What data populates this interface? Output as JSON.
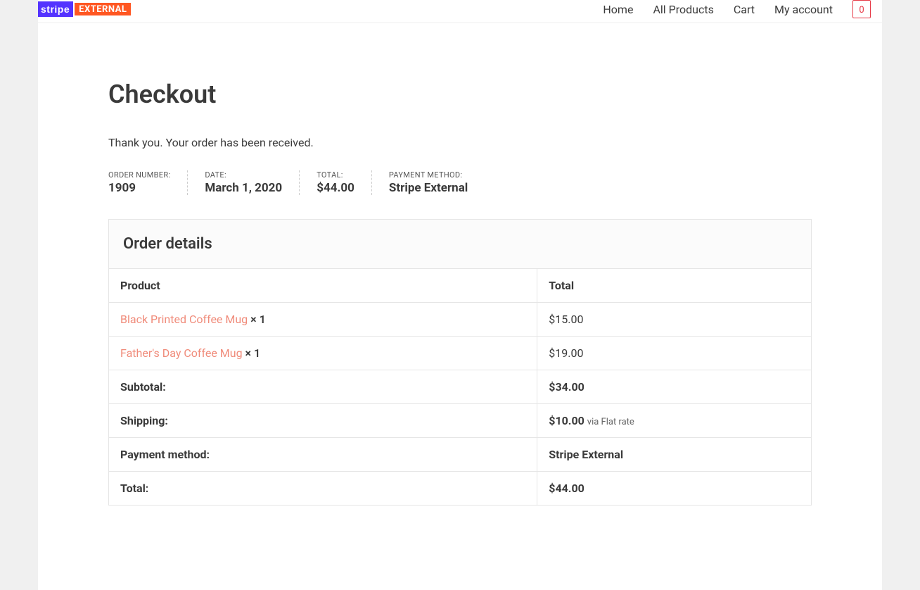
{
  "logo": {
    "part1": "stripe",
    "part2": "EXTERNAL"
  },
  "nav": {
    "home": "Home",
    "all_products": "All Products",
    "cart": "Cart",
    "my_account": "My account",
    "cart_count": "0"
  },
  "page": {
    "title": "Checkout",
    "thankyou": "Thank you. Your order has been received."
  },
  "meta": {
    "order_number_label": "ORDER NUMBER:",
    "order_number": "1909",
    "date_label": "DATE:",
    "date": "March 1, 2020",
    "total_label": "TOTAL:",
    "total": "$44.00",
    "payment_label": "PAYMENT METHOD:",
    "payment": "Stripe External"
  },
  "details": {
    "heading": "Order details",
    "col_product": "Product",
    "col_total": "Total",
    "items": [
      {
        "name": "Black Printed Coffee Mug",
        "qty": "× 1",
        "total": "$15.00"
      },
      {
        "name": "Father's Day Coffee Mug",
        "qty": "× 1",
        "total": "$19.00"
      }
    ],
    "subtotal_label": "Subtotal:",
    "subtotal": "$34.00",
    "shipping_label": "Shipping:",
    "shipping_cost": "$10.00",
    "shipping_note": "via Flat rate",
    "payment_label": "Payment method:",
    "payment": "Stripe External",
    "total_label": "Total:",
    "total": "$44.00"
  }
}
